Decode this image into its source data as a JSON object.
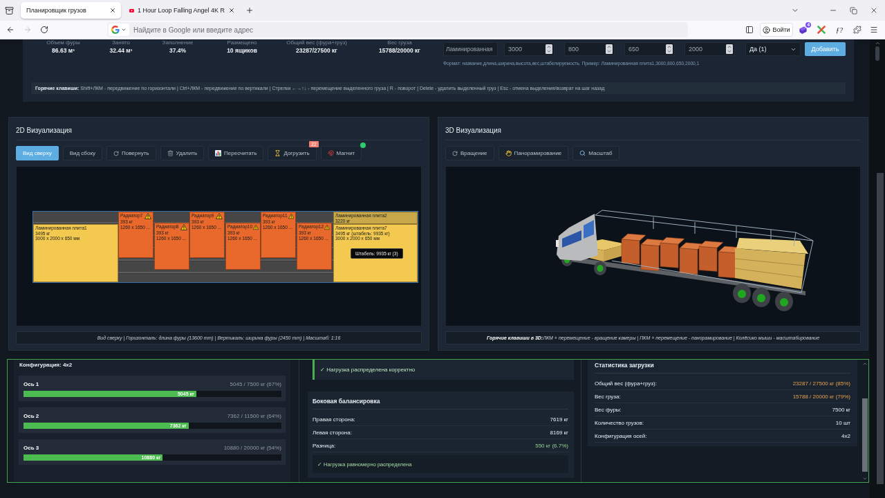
{
  "browser": {
    "tabs": [
      {
        "title": "Планировщик грузов",
        "selected": true,
        "icon": false
      },
      {
        "title": "1 Hour Loop Falling Angel 4K R",
        "selected": false,
        "icon": true
      }
    ],
    "forward_disabled": true,
    "address_placeholder": "Найдите в Google или введите адрес",
    "sign_in": "Войти",
    "extension_badge": "4",
    "formula_button": "ƒ?"
  },
  "summary": {
    "stats": [
      {
        "label": "Объем фуры",
        "value": "86.63 м³"
      },
      {
        "label": "Занято",
        "value": "32.44 м³"
      },
      {
        "label": "Заполнение",
        "value": "37.4%"
      },
      {
        "label": "Размещено",
        "value": "10 ящиков"
      },
      {
        "label": "Общий вес (фура+груз)",
        "value": "23287/27500 кг"
      },
      {
        "label": "Вес груза",
        "value": "15788/20000 кг"
      }
    ]
  },
  "cargo_form": {
    "name_value": "Ламинированная",
    "numbers": [
      "3000",
      "800",
      "650",
      "2000"
    ],
    "stackable": "Да (1)",
    "submit": "Добавить",
    "hint": "Формат: название,длина,ширина,высота,вес,штабелируемость. Пример: Ламинированная плита1,3000,800,650,2000,1"
  },
  "hotkeys": "**Горячие клавиши:** Shift+ЛКМ - передвижение по горизонтали | Ctrl+ЛКМ - передвижение по вертикали | Стрелки ←→↑↓ - перемещение выделенного груза | R - поворот | Delete - удалить выделенный груз | Esc - отмена выделения/возврат на шаг назад",
  "view_2d": {
    "title": "2D Визуализация",
    "buttons": [
      {
        "label": "Вид сверху",
        "selected": true,
        "on": false
      },
      {
        "label": "Вид сбоку",
        "selected": false,
        "on": false
      },
      {
        "label": "Повернуть",
        "selected": false,
        "on": false
      },
      {
        "label": "Удалить",
        "selected": false,
        "on": false
      },
      {
        "label": "Пересчитать",
        "selected": false,
        "on": false
      },
      {
        "label": "Догрузить",
        "selected": false,
        "on": false,
        "badge": "22"
      },
      {
        "label": "Магнит",
        "selected": false,
        "on": true
      }
    ],
    "cargo": [
      {
        "name": "Ламинированная плита1",
        "lines": [
          "3495 кг",
          "3000 x 2000 x 650 мм"
        ],
        "color": "#f4c94f",
        "warning": false
      },
      {
        "name": "Радиатор7",
        "lines": [
          "393 кг",
          "1260 x 1650 ..."
        ],
        "color": "#e9692c",
        "warning": true
      },
      {
        "name": "Радиатор8",
        "lines": [
          "393 кг",
          "1260 x 1650 ..."
        ],
        "color": "#e9692c",
        "warning": true
      },
      {
        "name": "Радиатор9",
        "lines": [
          "393 кг",
          "1260 x 1650 ..."
        ],
        "color": "#e9692c",
        "warning": true
      },
      {
        "name": "Радиатор10",
        "lines": [
          "393 кг",
          "1260 x 1650 ..."
        ],
        "color": "#e9692c",
        "warning": true
      },
      {
        "name": "Радиатор11",
        "lines": [
          "393 кг",
          "1260 x 1650 ..."
        ],
        "color": "#e9692c",
        "warning": true
      },
      {
        "name": "Радиатор12",
        "lines": [
          "393 кг",
          "1260 x 1650 ..."
        ],
        "color": "#e9692c",
        "warning": true
      },
      {
        "name": "Ламинированная плита2",
        "lines": [
          "3220 кг"
        ],
        "color": "#c9a84a",
        "warning": false
      },
      {
        "name": "Ламинированная плита7",
        "lines": [
          "3495 кг (штабель: 9935 кг)",
          "3000 x 2000 x 650 мм"
        ],
        "color": "#f4c94f",
        "warning": false
      }
    ],
    "tooltip": "Штабель: 9935 кг (3)",
    "caption": "Вид сверху | Горизонталь: длина фуры (13600 mm) | Вертикаль: ширина фуры (2450 mm) | Масштаб: 1:16"
  },
  "view_3d": {
    "title": "3D Визуализация",
    "buttons": [
      {
        "label": "Вращение"
      },
      {
        "label": "Панорамирование"
      },
      {
        "label": "Масштаб"
      }
    ],
    "caption": "**Горячие клавиши в 3D:**ЛКМ + перемещение - вращение камеры | ПКМ + перемещение - панорамирование | Колёсико мыши - масштабирование"
  },
  "axles": {
    "title": "Конфигурация: 4x2",
    "items": [
      {
        "name": "Ось 1",
        "reading": "5045 / 7500 кг (67%)",
        "level": 0.67,
        "bar_label": "5045 кг"
      },
      {
        "name": "Ось 2",
        "reading": "7362 / 11500 кг (64%)",
        "level": 0.64,
        "bar_label": "7362 кг"
      },
      {
        "name": "Ось 3",
        "reading": "10880 / 20000 кг (54%)",
        "level": 0.54,
        "bar_label": "10880 кг"
      }
    ]
  },
  "balance": {
    "status": "✓ Нагрузка распределена корректно",
    "title": "Боковая балансировка",
    "rows": [
      {
        "label": "Правая сторона:",
        "value": "7619 кг",
        "ok": false
      },
      {
        "label": "Левая сторона:",
        "value": "8169 кг",
        "ok": false
      },
      {
        "label": "Разница:",
        "value": "550 кг (6.7%)",
        "ok": true
      }
    ],
    "verdict": "✓ Нагрузка равномерно распределена"
  },
  "load_stats": {
    "title": "Статистика загрузки",
    "rows": [
      {
        "label": "Общий вес (фура+груз):",
        "value": "23287 / 27500 кг (85%)",
        "warning": true
      },
      {
        "label": "Вес груза:",
        "value": "15788 / 20000 кг (79%)",
        "warning": true
      },
      {
        "label": "Вес фуры:",
        "value": "7500 кг",
        "warning": false
      },
      {
        "label": "Количество грузов:",
        "value": "10 шт",
        "warning": false
      },
      {
        "label": "Конфигурация осей:",
        "value": "4x2",
        "warning": false
      }
    ]
  }
}
